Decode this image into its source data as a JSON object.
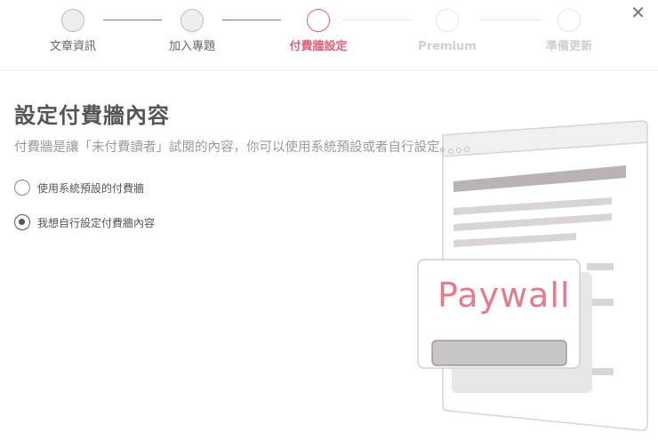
{
  "steps": [
    {
      "label": "文章資訊",
      "state": "done"
    },
    {
      "label": "加入專題",
      "state": "done"
    },
    {
      "label": "付費牆設定",
      "state": "active"
    },
    {
      "label": "Premium",
      "state": "future"
    },
    {
      "label": "準備更新",
      "state": "future"
    }
  ],
  "close_icon": "close-icon",
  "content": {
    "title": "設定付費牆內容",
    "description": "付費牆是讓「未付費讀者」試閱的內容，你可以使用系統預設或者自行設定。",
    "options": [
      {
        "label": "使用系統預設的付費牆",
        "checked": false
      },
      {
        "label": "我想自行設定付費牆內容",
        "checked": true
      }
    ]
  },
  "illustration": {
    "paywall_label": "Paywall"
  },
  "colors": {
    "accent": "#e0607a",
    "paywall_text": "#e57a8c"
  }
}
